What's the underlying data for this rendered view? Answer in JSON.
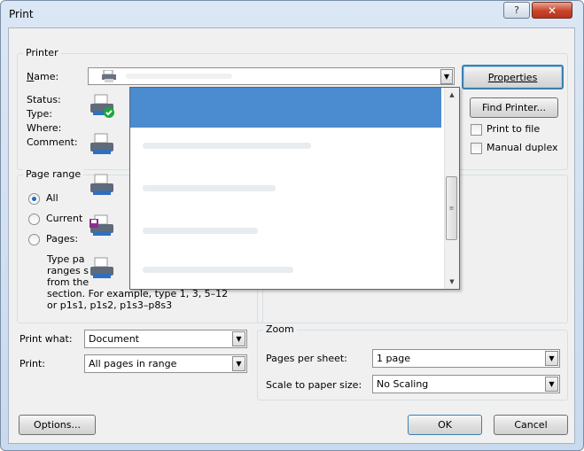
{
  "window": {
    "title": "Print",
    "help_glyph": "?",
    "close_glyph": "✕"
  },
  "printer": {
    "group_label": "Printer",
    "name_label_pre": "",
    "name_label_u": "N",
    "name_label_post": "ame:",
    "status_label": "Status:",
    "type_label": "Type:",
    "where_label": "Where:",
    "comment_label": "Comment:",
    "properties_label": "Properties",
    "find_printer_label": "Find Printer...",
    "print_to_file_label": "Print to file",
    "manual_duplex_label": "Manual duplex"
  },
  "page_range": {
    "group_label": "Page range",
    "all_label": "All",
    "current_label": "Current",
    "pages_label": "Pages:",
    "selected": "All",
    "help_line1": "Type pa",
    "help_line2": "ranges s",
    "help_line3": "from the",
    "help_line4": "section. For example, type 1, 3, 5–12",
    "help_line5": "or p1s1, p1s2, p1s3–p8s3"
  },
  "print_what": {
    "label": "Print what:",
    "value": "Document"
  },
  "print": {
    "label": "Print:",
    "value": "All pages in range"
  },
  "zoom": {
    "group_label": "Zoom",
    "pages_per_sheet_label": "Pages per sheet:",
    "pages_per_sheet_value": "1 page",
    "scale_label": "Scale to paper size:",
    "scale_value": "No Scaling"
  },
  "buttons": {
    "options": "Options...",
    "ok": "OK",
    "cancel": "Cancel"
  },
  "printer_list": {
    "items": [
      {
        "icon": "printer-default-icon",
        "selected": true
      },
      {
        "icon": "printer-icon",
        "selected": false
      },
      {
        "icon": "printer-icon",
        "selected": false
      },
      {
        "icon": "fax-printer-icon",
        "selected": false
      },
      {
        "icon": "printer-icon",
        "selected": false
      }
    ]
  },
  "colors": {
    "selection": "#4b8bcf",
    "focus_border": "#3c7fb1"
  }
}
